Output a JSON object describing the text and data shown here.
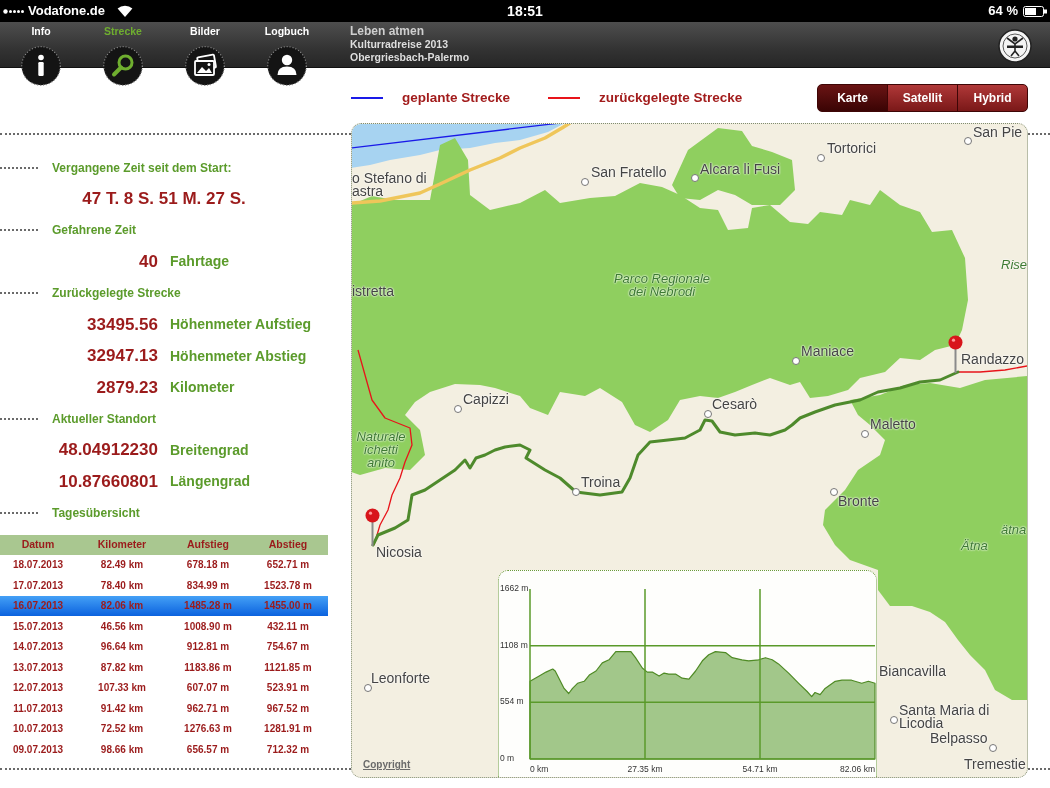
{
  "status_bar": {
    "carrier": "Vodafone.de",
    "time": "18:51",
    "battery": "64 %"
  },
  "toolbar": {
    "tabs": [
      {
        "label": "Info",
        "selected": false
      },
      {
        "label": "Strecke",
        "selected": true
      },
      {
        "label": "Bilder",
        "selected": false
      },
      {
        "label": "Logbuch",
        "selected": false
      }
    ],
    "title": "Leben atmen",
    "subtitle": [
      "Kulturradreise 2013",
      "Obergriesbach-Palermo"
    ]
  },
  "legend": [
    {
      "label": "geplante Strecke",
      "color": "#1a1ae8"
    },
    {
      "label": "zurückgelegte Strecke",
      "color": "#e8141a"
    }
  ],
  "map_types": [
    {
      "label": "Karte",
      "selected": true
    },
    {
      "label": "Satellit",
      "selected": false
    },
    {
      "label": "Hybrid",
      "selected": false
    }
  ],
  "summary": [
    {
      "heading": "Vergangene Zeit seit dem Start:",
      "items": [
        {
          "value": "47 T. 8 S. 51 M. 27 S."
        }
      ]
    },
    {
      "heading": "Gefahrene Zeit",
      "items": [
        {
          "value": "40",
          "label": "Fahrtage"
        }
      ]
    },
    {
      "heading": "Zurückgelegte Strecke",
      "items": [
        {
          "value": "33495.56",
          "label": "Höhenmeter Aufstieg"
        },
        {
          "value": "32947.13",
          "label": "Höhenmeter Abstieg"
        },
        {
          "value": "2879.23",
          "label": "Kilometer"
        }
      ]
    },
    {
      "heading": "Aktueller Standort",
      "items": [
        {
          "value": "48.04912230",
          "label": "Breitengrad"
        },
        {
          "value": "10.87660801",
          "label": "Längengrad"
        }
      ]
    },
    {
      "heading": "Tagesübersicht"
    }
  ],
  "day_table": {
    "columns": [
      "Datum",
      "Kilometer",
      "Aufstieg",
      "Abstieg"
    ],
    "rows": [
      {
        "cells": [
          "18.07.2013",
          "82.49 km",
          "678.18 m",
          "652.71 m"
        ],
        "selected": false
      },
      {
        "cells": [
          "17.07.2013",
          "78.40 km",
          "834.99 m",
          "1523.78 m"
        ],
        "selected": false
      },
      {
        "cells": [
          "16.07.2013",
          "82.06 km",
          "1485.28 m",
          "1455.00 m"
        ],
        "selected": true
      },
      {
        "cells": [
          "15.07.2013",
          "46.56 km",
          "1008.90 m",
          "432.11 m"
        ],
        "selected": false
      },
      {
        "cells": [
          "14.07.2013",
          "96.64 km",
          "912.81 m",
          "754.67 m"
        ],
        "selected": false
      },
      {
        "cells": [
          "13.07.2013",
          "87.82 km",
          "1183.86 m",
          "1121.85 m"
        ],
        "selected": false
      },
      {
        "cells": [
          "12.07.2013",
          "107.33 km",
          "607.07 m",
          "523.91 m"
        ],
        "selected": false
      },
      {
        "cells": [
          "11.07.2013",
          "91.42 km",
          "962.71 m",
          "967.52 m"
        ],
        "selected": false
      },
      {
        "cells": [
          "10.07.2013",
          "72.52 km",
          "1276.63 m",
          "1281.91 m"
        ],
        "selected": false
      },
      {
        "cells": [
          "09.07.2013",
          "98.66 km",
          "656.57 m",
          "712.32 m"
        ],
        "selected": false
      }
    ]
  },
  "map": {
    "places": [
      {
        "name": "o Stefano di astra",
        "kind": "town"
      },
      {
        "name": "San Fratello",
        "kind": "town"
      },
      {
        "name": "Alcara li Fusi",
        "kind": "town"
      },
      {
        "name": "Tortorici",
        "kind": "town"
      },
      {
        "name": "San Pie",
        "kind": "town"
      },
      {
        "name": "istretta",
        "kind": "town"
      },
      {
        "name": "Parco Regionale dei Nebrodi",
        "kind": "nature"
      },
      {
        "name": "Rise",
        "kind": "nature"
      },
      {
        "name": "Maniace",
        "kind": "town"
      },
      {
        "name": "Randazzo",
        "kind": "town"
      },
      {
        "name": "Capizzi",
        "kind": "town"
      },
      {
        "name": "Cesarò",
        "kind": "town"
      },
      {
        "name": "Naturale ichetti anito",
        "kind": "nature"
      },
      {
        "name": "Maletto",
        "kind": "town"
      },
      {
        "name": "Troina",
        "kind": "town"
      },
      {
        "name": "Bronte",
        "kind": "town"
      },
      {
        "name": "Nicosia",
        "kind": "town"
      },
      {
        "name": "ätna",
        "kind": "nature"
      },
      {
        "name": "Ätna",
        "kind": "nature"
      },
      {
        "name": "Leonforte",
        "kind": "town"
      },
      {
        "name": "Biancavilla",
        "kind": "town"
      },
      {
        "name": "Santa Maria di Licodia",
        "kind": "town"
      },
      {
        "name": "Belpasso",
        "kind": "town"
      },
      {
        "name": "Tremestie",
        "kind": "town"
      }
    ],
    "copyright": "Copyright",
    "elevation_chart": {
      "chart_data": {
        "type": "area",
        "x": [
          0,
          2.2,
          3.8,
          5.4,
          6.0,
          7.0,
          8.1,
          9.2,
          10.1,
          11.3,
          12.9,
          14.1,
          15.7,
          17.2,
          18.8,
          20.4,
          24.0,
          25.1,
          26.7,
          27.9,
          29.1,
          30.7,
          31.9,
          33.0,
          34.6,
          36.2,
          37.8,
          39.4,
          41.0,
          42.5,
          44.1,
          46.5,
          48.1,
          50.4,
          52.0,
          54.4,
          56.0,
          57.6,
          59.1,
          61.5,
          63.9,
          65.9,
          67.0,
          67.8,
          69.0,
          70.2,
          72.6,
          74.2,
          76.5,
          78.9,
          80.5,
          82.06
        ],
        "values": [
          760,
          810,
          850,
          880,
          860,
          780,
          690,
          640,
          690,
          740,
          760,
          820,
          860,
          940,
          970,
          1050,
          1050,
          990,
          890,
          850,
          850,
          810,
          840,
          830,
          830,
          790,
          780,
          860,
          960,
          1020,
          1050,
          1040,
          990,
          970,
          960,
          970,
          990,
          970,
          930,
          840,
          740,
          660,
          610,
          650,
          630,
          690,
          760,
          770,
          770,
          740,
          760,
          740
        ],
        "xlim": [
          0,
          82.06
        ],
        "ylim": [
          0,
          1662
        ],
        "xticks": [
          {
            "value": 0,
            "label": "0 km"
          },
          {
            "value": 27.35,
            "label": "27.35 km"
          },
          {
            "value": 54.71,
            "label": "54.71 km"
          },
          {
            "value": 82.06,
            "label": "82.06 km"
          }
        ],
        "yticks": [
          {
            "value": 0,
            "label": "0 m"
          },
          {
            "value": 554,
            "label": "554 m"
          },
          {
            "value": 1108,
            "label": "1108 m"
          },
          {
            "value": 1662,
            "label": "1662 m"
          }
        ],
        "grid": true
      }
    }
  }
}
